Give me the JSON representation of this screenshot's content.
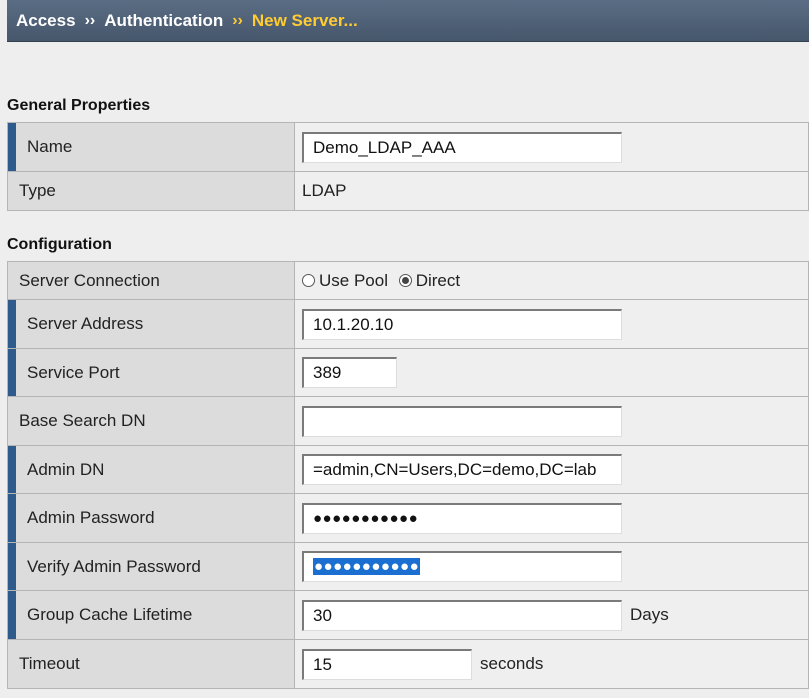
{
  "breadcrumb": {
    "items": [
      "Access",
      "Authentication",
      "New Server..."
    ],
    "separator": "››"
  },
  "general": {
    "title": "General Properties",
    "name": {
      "label": "Name",
      "value": "Demo_LDAP_AAA"
    },
    "type": {
      "label": "Type",
      "value": "LDAP"
    }
  },
  "config": {
    "title": "Configuration",
    "server_connection": {
      "label": "Server Connection",
      "options": [
        {
          "label": "Use Pool",
          "checked": false
        },
        {
          "label": "Direct",
          "checked": true
        }
      ]
    },
    "server_address": {
      "label": "Server Address",
      "value": "10.1.20.10"
    },
    "service_port": {
      "label": "Service Port",
      "value": "389"
    },
    "base_search_dn": {
      "label": "Base Search DN",
      "value": ""
    },
    "admin_dn": {
      "label": "Admin DN",
      "value": "=admin,CN=Users,DC=demo,DC=lab"
    },
    "admin_password": {
      "label": "Admin Password",
      "value": "●●●●●●●●●●●"
    },
    "verify_admin_password": {
      "label": "Verify Admin Password",
      "value": "●●●●●●●●●●●"
    },
    "group_cache_lifetime": {
      "label": "Group Cache Lifetime",
      "value": "30",
      "unit": "Days"
    },
    "timeout": {
      "label": "Timeout",
      "value": "15",
      "unit": "seconds"
    }
  },
  "colors": {
    "header_bg": "#4f6178",
    "breadcrumb_current": "#ffcc33",
    "required_marker": "#2f5b8c",
    "selection": "#1a6fd1"
  }
}
